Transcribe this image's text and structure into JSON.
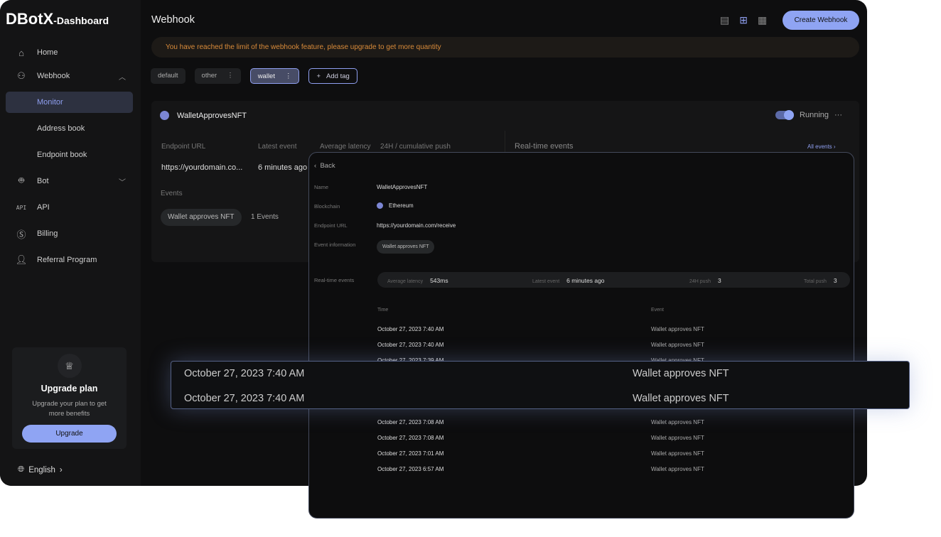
{
  "app": {
    "brand": "DBotX",
    "brand_suffix": "-Dashboard"
  },
  "sidebar": {
    "items": [
      {
        "label": "Home",
        "icon": "home-icon"
      },
      {
        "label": "Webhook",
        "icon": "webhook-icon"
      },
      {
        "label": "Monitor"
      },
      {
        "label": "Address book"
      },
      {
        "label": "Endpoint book"
      },
      {
        "label": "Bot",
        "icon": "robot-icon"
      },
      {
        "label": "API",
        "icon": "api-icon"
      },
      {
        "label": "Billing",
        "icon": "dollar-icon"
      },
      {
        "label": "Referral Program",
        "icon": "user-plus-icon"
      }
    ],
    "api_icon_text": "API",
    "upgrade": {
      "title": "Upgrade plan",
      "text": "Upgrade your plan to get more benefits",
      "button": "Upgrade"
    },
    "language": "English"
  },
  "header": {
    "title": "Webhook",
    "create_button": "Create Webhook"
  },
  "alert": "You have reached the limit of the webhook feature, please upgrade to get more quantity",
  "tags": [
    "default",
    "other",
    "wallet"
  ],
  "add_tag": "Add tag",
  "selected_tag": "wallet",
  "card": {
    "name": "WalletApprovesNFT",
    "status": "Running",
    "endpoint_label": "Endpoint URL",
    "endpoint": "https://yourdomain.co...",
    "latest_label": "Latest event",
    "latest": "6 minutes ago",
    "avg_label": "Average latency",
    "push_label": "24H / cumulative push",
    "events_label": "Events",
    "event_chip": "Wallet approves NFT",
    "events_count": "1 Events",
    "realtime_label": "Real-time events",
    "all_events": "All events"
  },
  "detail": {
    "back": "Back",
    "name_label": "Name",
    "name": "WalletApprovesNFT",
    "chain_label": "Blockchain",
    "chain": "Ethereum",
    "url_label": "Endpoint URL",
    "url": "https://yourdomain.com/receive",
    "info_label": "Event information",
    "info_chip": "Wallet approves NFT",
    "rt_label": "Real-time events",
    "stats": {
      "avg_label": "Average latency",
      "avg": "543ms",
      "latest_label": "Latest event",
      "latest": "6 minutes ago",
      "push24_label": "24H push",
      "push24": "3",
      "total_label": "Total push",
      "total": "3"
    },
    "columns": [
      "Time",
      "Event"
    ],
    "rows": [
      {
        "time": "October 27, 2023 7:40 AM",
        "event": "Wallet approves NFT"
      },
      {
        "time": "October 27, 2023 7:40 AM",
        "event": "Wallet approves NFT"
      },
      {
        "time": "October 27, 2023 7:39 AM",
        "event": "Wallet approves NFT"
      },
      {
        "time": "October 27, 2023 7:08 AM",
        "event": "Wallet approves NFT"
      },
      {
        "time": "October 27, 2023 7:08 AM",
        "event": "Wallet approves NFT"
      },
      {
        "time": "October 27, 2023 7:01 AM",
        "event": "Wallet approves NFT"
      },
      {
        "time": "October 27, 2023 6:57 AM",
        "event": "Wallet approves NFT"
      }
    ]
  },
  "highlight": [
    {
      "time": "October 27, 2023 7:40 AM",
      "event": "Wallet approves NFT"
    },
    {
      "time": "October 27, 2023 7:40 AM",
      "event": "Wallet approves NFT"
    }
  ],
  "colors": {
    "accent": "#8fa4f3",
    "warning": "#d98b3a",
    "background": "#0e0e0f"
  }
}
